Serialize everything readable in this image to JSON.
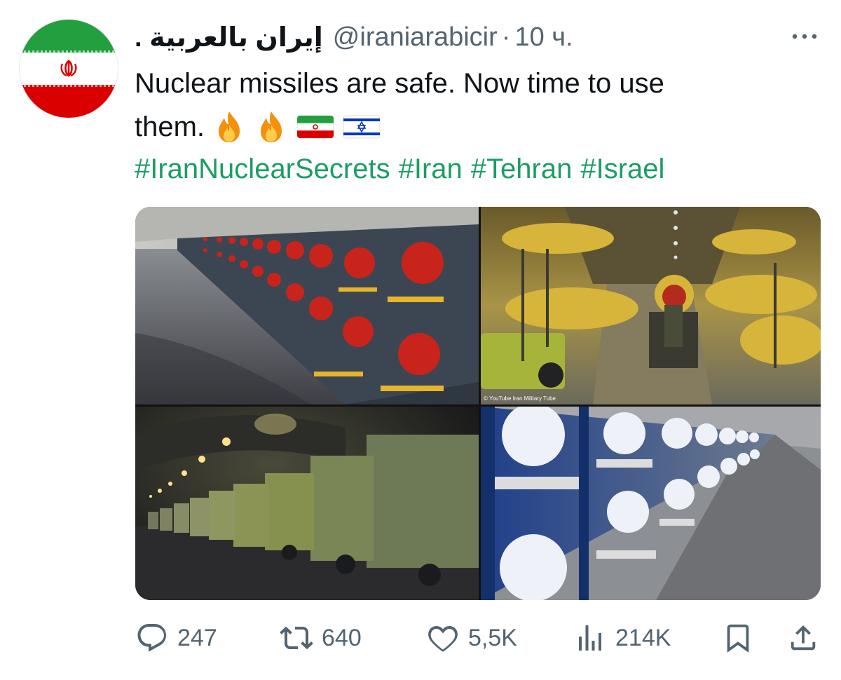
{
  "author": {
    "display_name": "إيران بالعربية .",
    "handle": "@iraniarabicir",
    "separator": "·",
    "time": "10 ч."
  },
  "tweet": {
    "line1": "Nuclear missiles are safe. Now time to use",
    "line2": "them.",
    "emojis": [
      "fire",
      "fire",
      "iran-flag",
      "israel-flag"
    ],
    "hashtags": [
      "#IranNuclearSecrets",
      "#Iran",
      "#Tehran",
      "#Israel"
    ]
  },
  "media": {
    "watermark": "© YouTube Iran Military Tube"
  },
  "actions": {
    "reply_count": "247",
    "retweet_count": "640",
    "like_count": "5,5K",
    "view_count": "214K"
  },
  "colors": {
    "hashtag": "#1c9d64",
    "muted": "#536471",
    "text": "#0f1419"
  },
  "icons": [
    "more-icon",
    "reply-icon",
    "retweet-icon",
    "like-icon",
    "views-icon",
    "bookmark-icon",
    "share-icon"
  ]
}
